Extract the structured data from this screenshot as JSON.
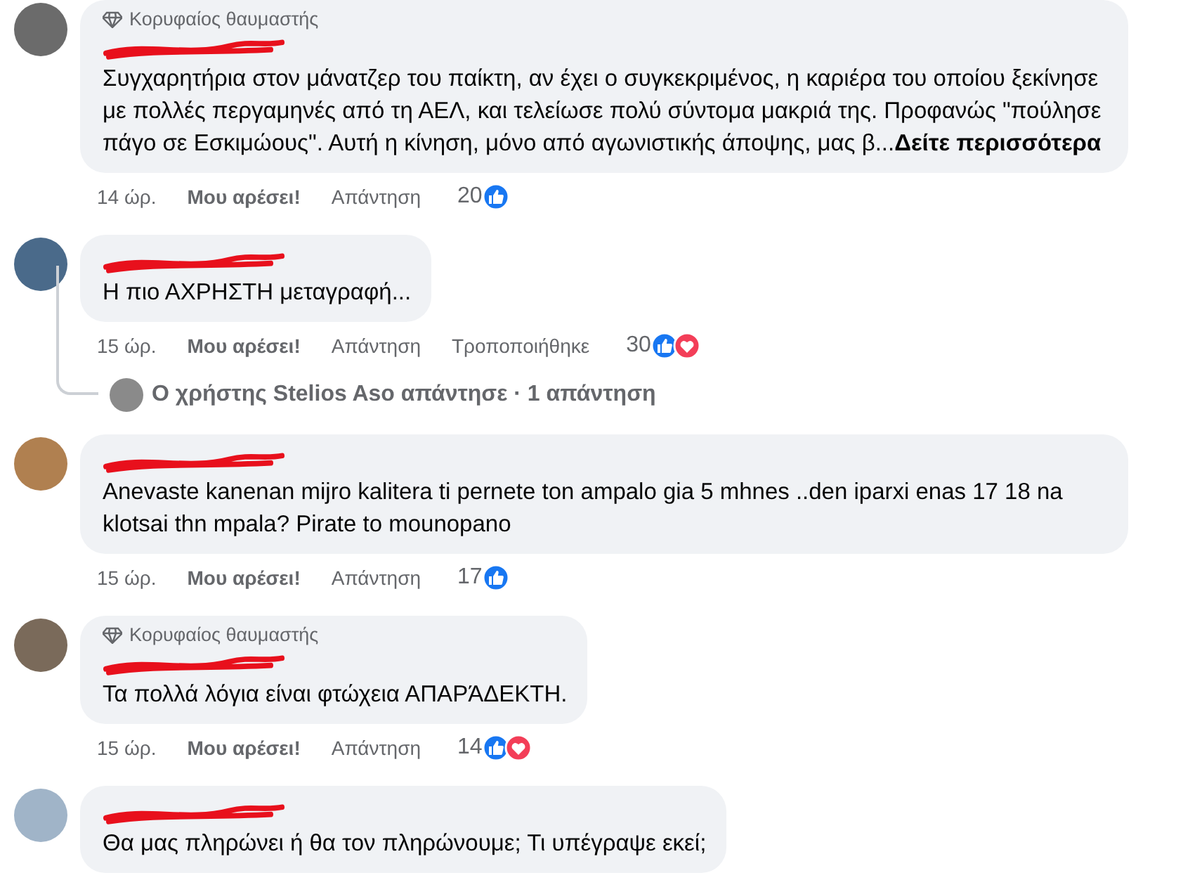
{
  "comments": [
    {
      "badge": "Κορυφαίος θαυμαστής",
      "name_redacted": true,
      "text": "Συγχαρητήρια στον μάνατζερ του παίκτη, αν έχει ο συγκεκριμένος, η καριέρα του οποίου ξεκίνησε με πολλές περγαμηνές από τη ΑΕΛ, και τελείωσε πολύ σύντομα μακριά της. Προφανώς \"πούλησε πάγο σε Εσκιμώους\". Αυτή η κίνηση, μόνο από αγωνιστικής άποψης, μας β...",
      "see_more": "Δείτε περισσότερα",
      "time": "14 ώρ.",
      "like": "Μου αρέσει!",
      "reply": "Απάντηση",
      "count": "20",
      "reactions": {
        "like": true
      }
    },
    {
      "name_redacted": true,
      "text": "Η πιο ΑΧΡΗΣΤΗ μεταγραφή...",
      "time": "15 ώρ.",
      "like": "Μου αρέσει!",
      "reply": "Απάντηση",
      "edited": "Τροποποιήθηκε",
      "count": "30",
      "reactions": {
        "like": true,
        "love": true
      },
      "replies_link": "Ο χρήστης Stelios Aso απάντησε · 1 απάντηση"
    },
    {
      "name_redacted": true,
      "text": "Anevaste kanenan mijro kalitera ti pernete ton ampalo gia 5 mhnes ..den iparxi enas 17 18 na klotsai thn mpala? Pirate to mounopano",
      "time": "15 ώρ.",
      "like": "Μου αρέσει!",
      "reply": "Απάντηση",
      "count": "17",
      "reactions": {
        "like": true
      }
    },
    {
      "badge": "Κορυφαίος θαυμαστής",
      "name_redacted": true,
      "text": "Τα πολλά λόγια είναι φτώχεια ΑΠΑΡΆΔΕΚΤΗ.",
      "time": "15 ώρ.",
      "like": "Μου αρέσει!",
      "reply": "Απάντηση",
      "count": "14",
      "reactions": {
        "like": true,
        "love": true
      }
    },
    {
      "name_redacted": true,
      "text": "Θα μας πληρώνει ή θα τον πληρώνουμε; Τι υπέγραψε εκεί;"
    }
  ]
}
